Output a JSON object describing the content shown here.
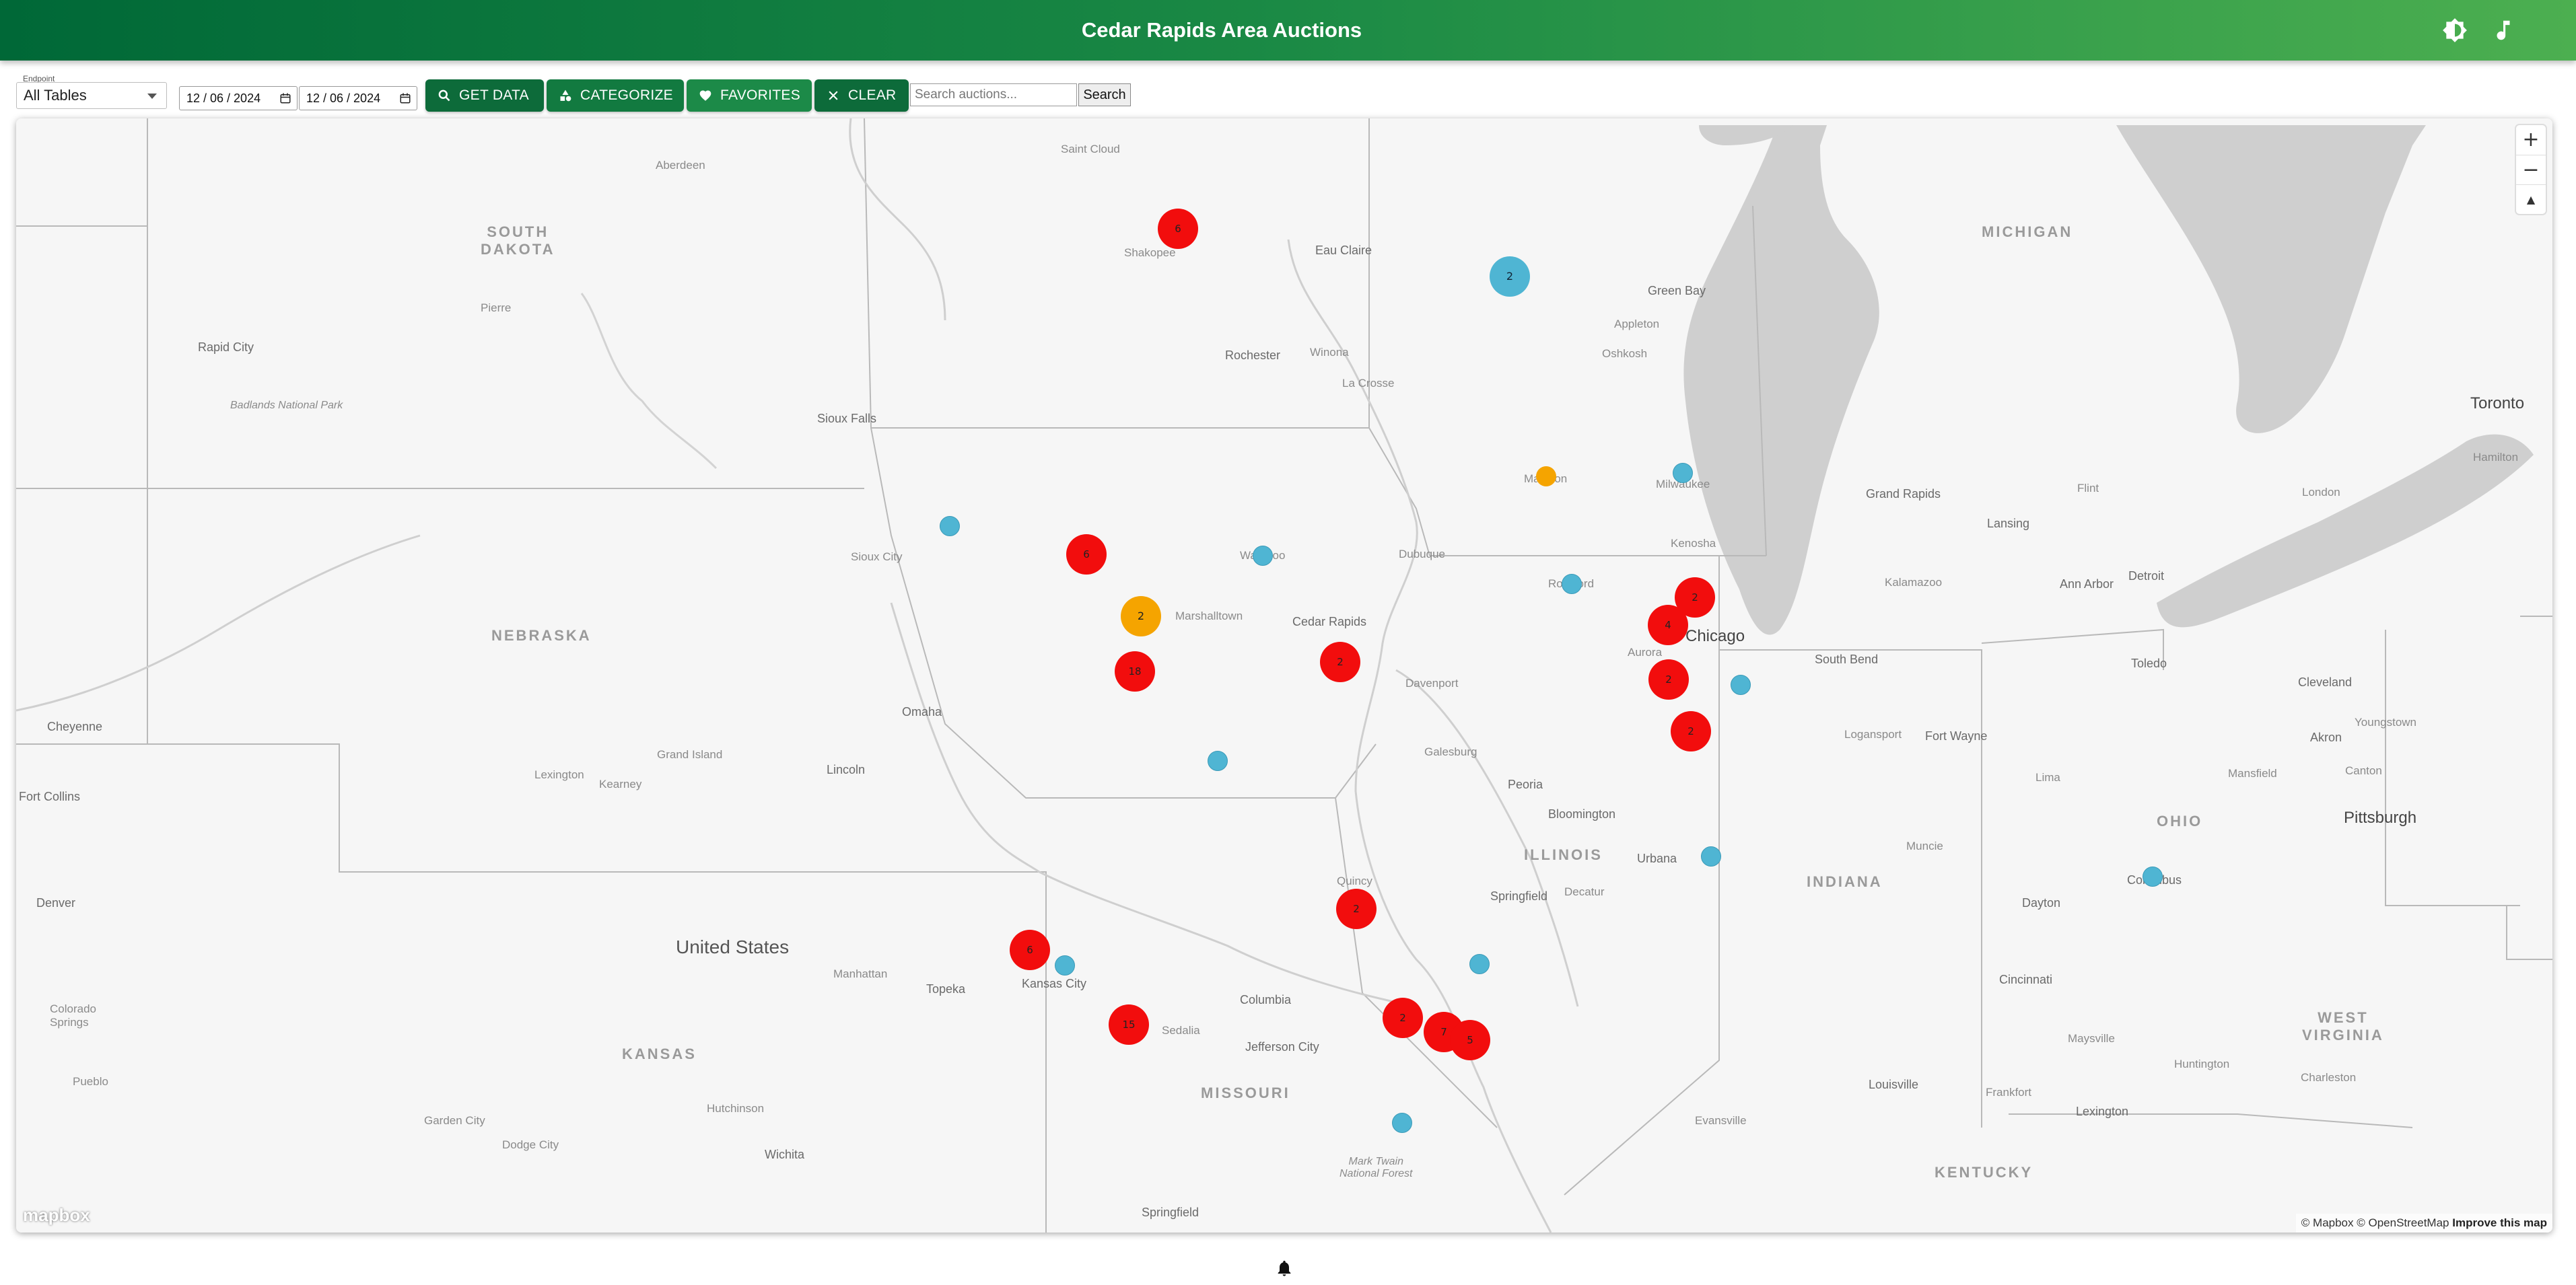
{
  "header": {
    "title": "Cedar Rapids Area Auctions",
    "icons": {
      "theme": "brightness-icon",
      "music": "music-note-icon"
    }
  },
  "toolbar": {
    "endpoint_legend": "Endpoint",
    "endpoint_value": "All Tables",
    "date_start": "12 / 06 / 2024",
    "date_end": "12 / 06 / 2024",
    "get_data_label": "GET DATA",
    "categorize_label": "CATEGORIZE",
    "favorites_label": "FAVORITES",
    "clear_label": "CLEAR",
    "search_placeholder": "Search auctions...",
    "search_label": "Search"
  },
  "map": {
    "labels": {
      "south_dakota": "SOUTH\nDAKOTA",
      "nebraska": "NEBRASKA",
      "kansas": "KANSAS",
      "missouri": "MISSOURI",
      "illinois": "ILLINOIS",
      "indiana": "INDIANA",
      "ohio": "OHIO",
      "kentucky": "KENTUCKY",
      "michigan": "MICHIGAN",
      "west_virginia": "WEST\nVIRGINIA",
      "united_states": "United States",
      "chicago": "Chicago",
      "toronto": "Toronto",
      "detroit": "Detroit",
      "cedar_rapids": "Cedar Rapids",
      "marshalltown": "Marshalltown",
      "davenport": "Davenport",
      "dubuque": "Dubuque",
      "waterloo": "Waterloo",
      "sioux_city": "Sioux City",
      "sioux_falls": "Sioux Falls",
      "omaha": "Omaha",
      "lincoln": "Lincoln",
      "kansas_city": "Kansas City",
      "topeka": "Topeka",
      "columbia": "Columbia",
      "jefferson_city": "Jefferson City",
      "springfield_mo": "Springfield",
      "springfield_il": "Springfield",
      "peoria": "Peoria",
      "bloomington": "Bloomington",
      "urbana": "Urbana",
      "galesburg": "Galesburg",
      "quincy": "Quincy",
      "rockford": "Rockford",
      "aurora": "Aurora",
      "madison": "Madison",
      "milwaukee": "Milwaukee",
      "kenosha": "Kenosha",
      "south_bend": "South Bend",
      "fort_wayne": "Fort Wayne",
      "toledo": "Toledo",
      "cleveland": "Cleveland",
      "akron": "Akron",
      "columbus": "Columbus",
      "pittsburgh": "Pittsburgh",
      "dayton": "Dayton",
      "cincinnati": "Cincinnati",
      "louisville": "Louisville",
      "lexington_ky": "Lexington",
      "rochester": "Rochester",
      "eau_claire": "Eau Claire",
      "la_crosse": "La Crosse",
      "winona": "Winona",
      "saint_cloud": "Saint Cloud",
      "shakopee": "Shakopee",
      "green_bay": "Green Bay",
      "appleton": "Appleton",
      "oshkosh": "Oshkosh",
      "grand_rapids": "Grand Rapids",
      "lansing": "Lansing",
      "ann_arbor": "Ann Arbor",
      "kalamazoo": "Kalamazoo",
      "flint": "Flint",
      "denver": "Denver",
      "rapid_city": "Rapid City",
      "cheyenne": "Cheyenne",
      "fort_collins": "Fort Collins",
      "wichita": "Wichita",
      "manhattan": "Manhattan",
      "evansville": "Evansville",
      "decatur": "Decatur",
      "muncie": "Muncie",
      "logansport": "Logansport",
      "hamilton": "Hamilton",
      "london": "London",
      "badlands": "Badlands National Park",
      "mark_twain": "Mark Twain\nNational Forest",
      "grand_island": "Grand Island",
      "kearney": "Kearney",
      "lexington_ne": "Lexington",
      "pierre": "Pierre",
      "sedalia": "Sedalia",
      "colorado_springs": "Colorado\nSprings",
      "pueblo": "Pueblo",
      "aberdeen": "Aberdeen",
      "mansfield": "Mansfield",
      "youngstown": "Youngstown",
      "canton": "Canton",
      "lima": "Lima",
      "charleston": "Charleston",
      "huntington": "Huntington",
      "maysville": "Maysville",
      "frankfort": "Frankfort",
      "dodge_city": "Dodge City",
      "garden_city": "Garden City",
      "hutchinson": "Hutchinson"
    },
    "markers": [
      {
        "name": "marker-shakopee",
        "type": "red",
        "count": "6"
      },
      {
        "name": "marker-eau-claire-east",
        "type": "blue-lg",
        "count": "2"
      },
      {
        "name": "marker-madison",
        "type": "orange",
        "count": ""
      },
      {
        "name": "marker-milwaukee",
        "type": "blue",
        "count": ""
      },
      {
        "name": "marker-sioux-city-east",
        "type": "blue",
        "count": ""
      },
      {
        "name": "marker-fort-dodge",
        "type": "red",
        "count": "6"
      },
      {
        "name": "marker-waterloo",
        "type": "blue",
        "count": ""
      },
      {
        "name": "marker-marshalltown",
        "type": "orange-lg",
        "count": "2"
      },
      {
        "name": "marker-des-moines",
        "type": "red",
        "count": "18"
      },
      {
        "name": "marker-cedar-rapids",
        "type": "red",
        "count": "2"
      },
      {
        "name": "marker-rockford",
        "type": "blue",
        "count": ""
      },
      {
        "name": "marker-chicago-north",
        "type": "red",
        "count": "2"
      },
      {
        "name": "marker-chicago-west",
        "type": "red",
        "count": "4"
      },
      {
        "name": "marker-aurora",
        "type": "red",
        "count": "2"
      },
      {
        "name": "marker-chicago-south",
        "type": "blue",
        "count": ""
      },
      {
        "name": "marker-joliet",
        "type": "red",
        "count": "2"
      },
      {
        "name": "marker-ottumwa",
        "type": "blue",
        "count": ""
      },
      {
        "name": "marker-urbana",
        "type": "blue",
        "count": ""
      },
      {
        "name": "marker-columbus",
        "type": "blue",
        "count": ""
      },
      {
        "name": "marker-quincy",
        "type": "red",
        "count": "2"
      },
      {
        "name": "marker-st-joseph",
        "type": "red",
        "count": "6"
      },
      {
        "name": "marker-kansas-city",
        "type": "blue",
        "count": ""
      },
      {
        "name": "marker-springfield-il-south",
        "type": "blue",
        "count": ""
      },
      {
        "name": "marker-sedalia",
        "type": "red",
        "count": "15"
      },
      {
        "name": "marker-st-louis-west",
        "type": "red",
        "count": "2"
      },
      {
        "name": "marker-st-louis",
        "type": "red",
        "count": "7"
      },
      {
        "name": "marker-st-louis-east",
        "type": "red",
        "count": "5"
      },
      {
        "name": "marker-mark-twain",
        "type": "blue",
        "count": ""
      }
    ],
    "zoom_in": "+",
    "zoom_out": "−",
    "compass": "▲",
    "mapbox_logo": "mapbox",
    "attribution": "© Mapbox © OpenStreetMap",
    "improve": "Improve this map"
  },
  "footer": {
    "icon": "bell-icon"
  },
  "colors": {
    "header_start": "#006837",
    "header_end": "#4caf50",
    "marker_red": "#f20d0d",
    "marker_blue": "#4fb5d3",
    "marker_orange": "#f5a400"
  }
}
